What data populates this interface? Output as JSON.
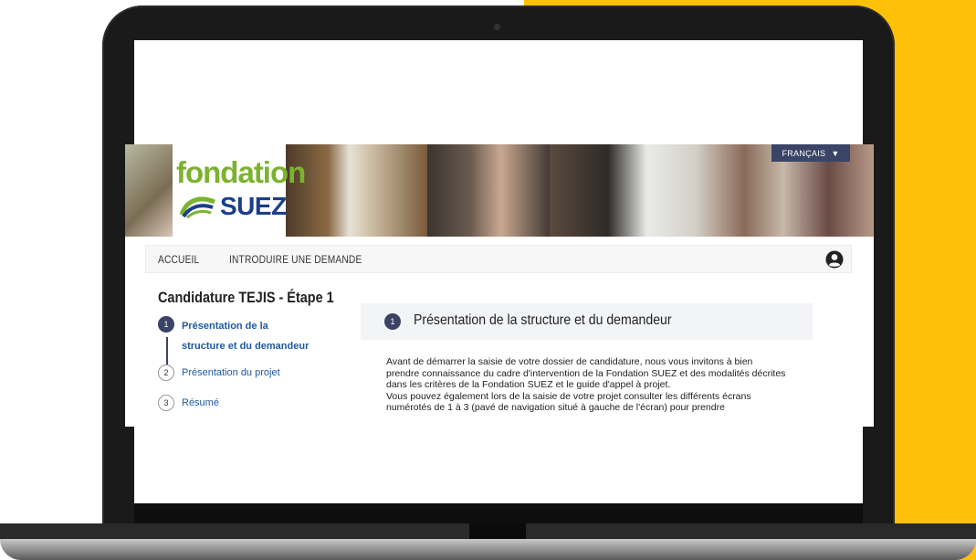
{
  "language_selector": {
    "label": "FRANÇAIS",
    "icon": "chevron-down-icon"
  },
  "logo": {
    "word1": "fondation",
    "word2": "SUEZ"
  },
  "nav": {
    "items": [
      {
        "label": "ACCUEIL"
      },
      {
        "label": "INTRODUIRE UNE DEMANDE"
      }
    ],
    "user_icon": "user-circle-icon"
  },
  "sidebar": {
    "title": "Candidature TEJIS - Étape 1",
    "steps": [
      {
        "number": "1",
        "label_line1": "Présentation de la",
        "label_line2": "structure et du demandeur",
        "active": true
      },
      {
        "number": "2",
        "label": "Présentation du projet",
        "active": false
      },
      {
        "number": "3",
        "label": "Résumé",
        "active": false
      }
    ]
  },
  "main": {
    "step_number": "1",
    "title": "Présentation de la structure et du demandeur",
    "paragraphs": [
      "Avant de démarrer la saisie de votre dossier de candidature, nous vous invitons à bien prendre connaissance du cadre d'intervention de la Fondation SUEZ et des modalités décrites dans les critères de la Fondation SUEZ et le guide d'appel à projet.",
      "Vous pouvez également lors de la saisie de votre projet consulter les différents écrans numérotés de 1 à 3 (pavé de navigation situé à gauche de l'écran) pour prendre"
    ]
  },
  "colors": {
    "accent_navy": "#3a4466",
    "link_blue": "#1e5aa0",
    "logo_green": "#7bb32e",
    "logo_blue": "#1b3d8c",
    "background_yellow": "#ffc107"
  }
}
